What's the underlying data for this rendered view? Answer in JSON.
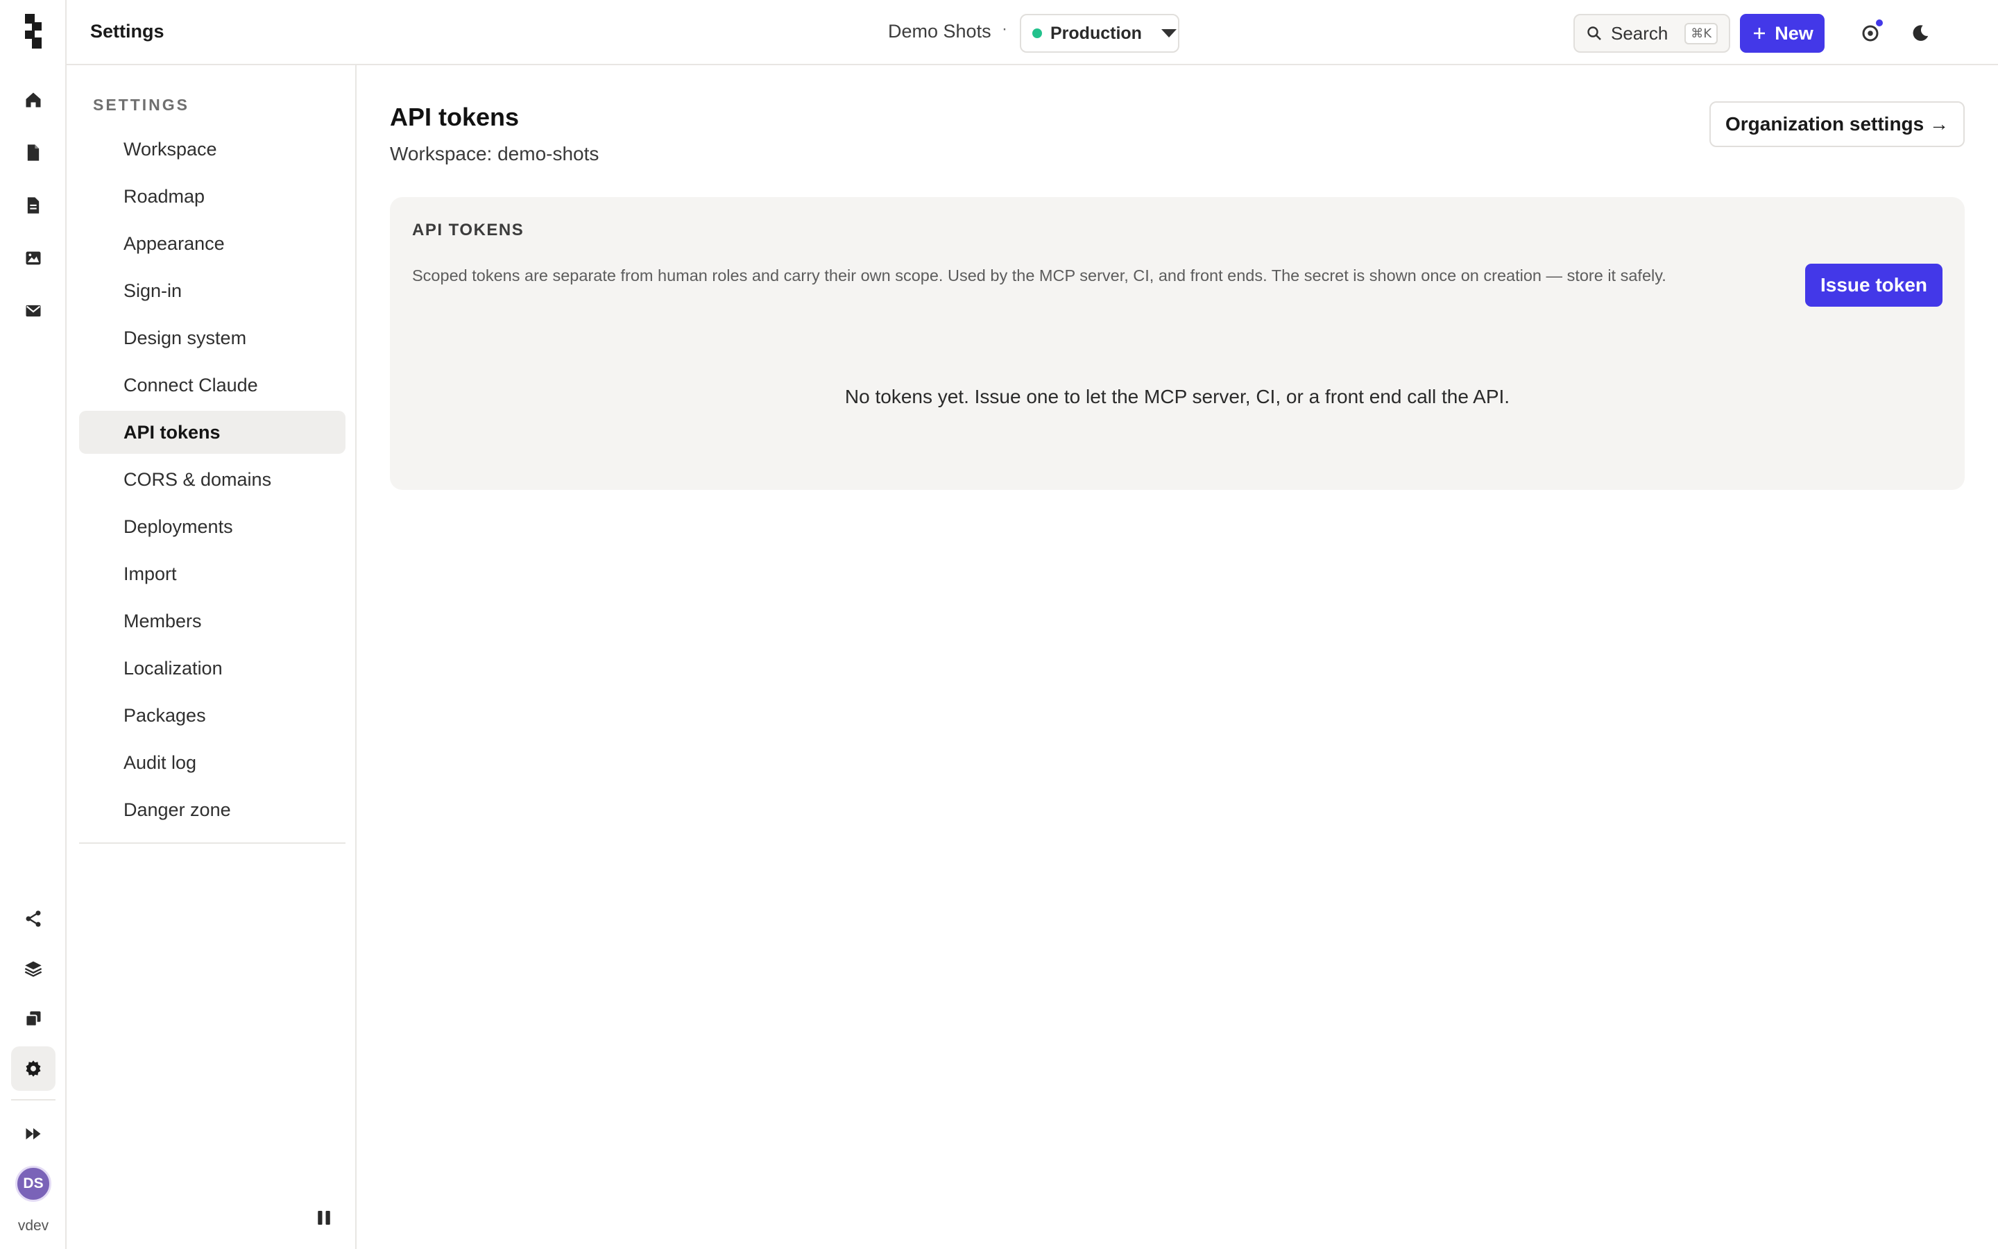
{
  "app": {
    "title": "Settings",
    "workspace_name": "Demo Shots",
    "separator": "·"
  },
  "environment": {
    "label": "Production",
    "status_color": "#22c18c"
  },
  "search": {
    "label": "Search",
    "shortcut": "⌘K"
  },
  "new_button": {
    "label": "New"
  },
  "help": {
    "label": "?"
  },
  "accent_color": "#4338e8",
  "rail": {
    "top_icons": [
      "home-icon",
      "page-icon",
      "document-icon",
      "image-icon",
      "mail-icon"
    ],
    "bottom_icons": [
      "share-icon",
      "layers-icon",
      "copy-icon",
      "gear-icon"
    ],
    "active": "gear-icon",
    "avatar_initials": "DS",
    "version": "vdev"
  },
  "sidebar": {
    "heading": "SETTINGS",
    "items": [
      {
        "label": "Workspace"
      },
      {
        "label": "Roadmap"
      },
      {
        "label": "Appearance"
      },
      {
        "label": "Sign-in"
      },
      {
        "label": "Design system"
      },
      {
        "label": "Connect Claude"
      },
      {
        "label": "API tokens"
      },
      {
        "label": "CORS & domains"
      },
      {
        "label": "Deployments"
      },
      {
        "label": "Import"
      },
      {
        "label": "Members"
      },
      {
        "label": "Localization"
      },
      {
        "label": "Packages"
      },
      {
        "label": "Audit log"
      },
      {
        "label": "Danger zone"
      }
    ],
    "active_index": 6
  },
  "main": {
    "title": "API tokens",
    "subtitle": "Workspace: demo-shots",
    "org_settings_label": "Organization settings →",
    "card": {
      "title": "API TOKENS",
      "description": "Scoped tokens are separate from human roles and carry their own scope. Used by the MCP server, CI, and front ends. The secret is shown once on creation — store it safely.",
      "issue_button": "Issue token",
      "empty_state": "No tokens yet. Issue one to let the MCP server, CI, or a front end call the API."
    }
  }
}
